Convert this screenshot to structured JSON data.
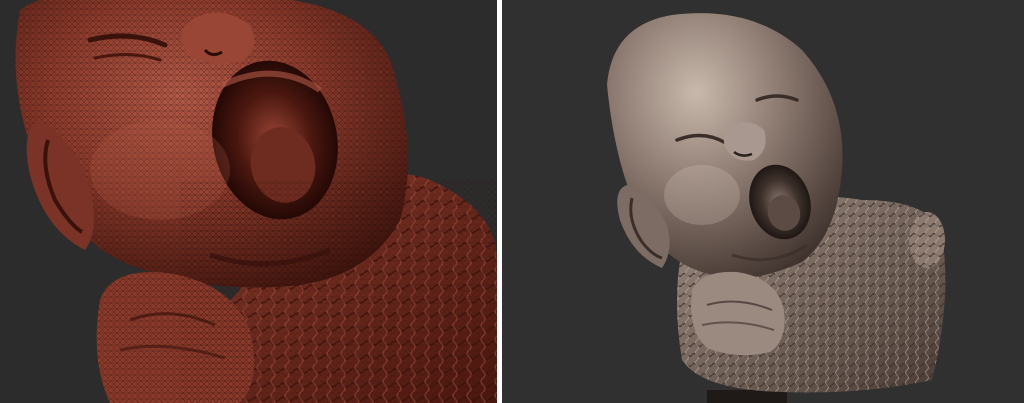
{
  "scene": {
    "left_view": {
      "render_style": "wireframe-mesh",
      "subject": "baby-bust-sculpt",
      "base_color": "#7a3326",
      "highlight_color": "#b35a48",
      "shadow_color": "#3a120c",
      "wire_color": "#2a0b07"
    },
    "right_view": {
      "render_style": "smooth-matcap",
      "subject": "baby-bust-sculpt",
      "base_color": "#7d6c63",
      "highlight_color": "#c9b8ac",
      "shadow_color": "#3b2e29"
    },
    "background_color": "#2b2b2b",
    "divider_color": "#ffffff"
  }
}
